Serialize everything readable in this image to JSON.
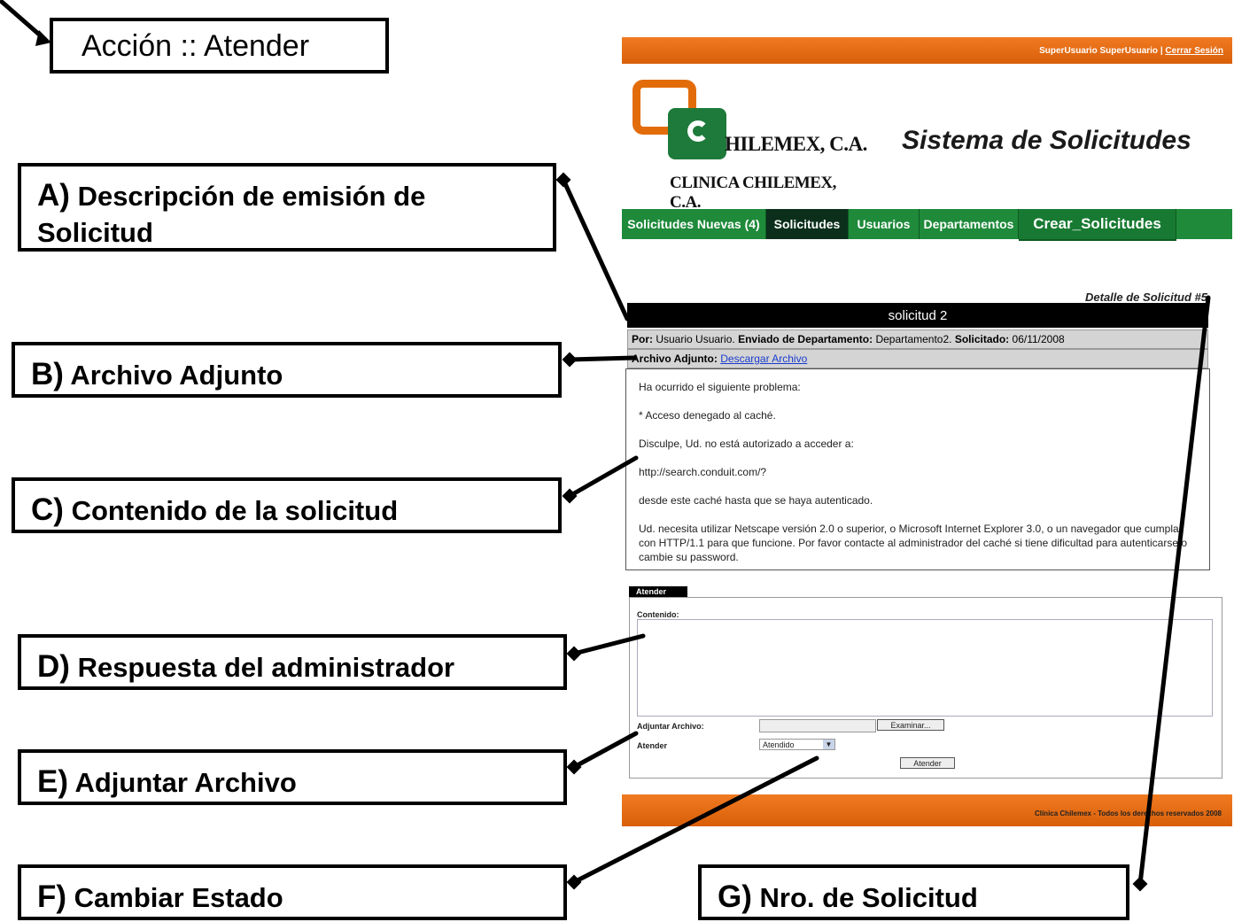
{
  "diagram_title": "Acción :: Atender",
  "callouts": {
    "a_letter": "A)",
    "a_line1": "Descripción de emisión de",
    "a_line2": "Solicitud",
    "b_letter": "B)",
    "b_text": "Archivo Adjunto",
    "c_letter": "C)",
    "c_text": "Contenido de la solicitud",
    "d_letter": "D)",
    "d_text": "Respuesta del administrador",
    "e_letter": "E)",
    "e_text": "Adjuntar Archivo",
    "f_letter": "F)",
    "f_text": "Cambiar Estado",
    "g_letter": "G)",
    "g_text": "Nro. de Solicitud"
  },
  "app": {
    "user": "SuperUsuario SuperUsuario",
    "separator": "|",
    "logout": "Cerrar Sesión",
    "logo_name": "HILEMEX, C.A.",
    "logo_sub": "CLINICA CHILEMEX, C.A.",
    "system_title": "Sistema de Solicitudes",
    "nav": [
      "Solicitudes Nuevas (4)",
      "Solicitudes",
      "Usuarios",
      "Departamentos",
      "Crear_Solicitudes"
    ],
    "detail_label": "Detalle de Solicitud #5",
    "request_title": "solicitud 2",
    "meta": {
      "by_label": "Por:",
      "by_value": "Usuario Usuario.",
      "dept_label": "Enviado de Departamento:",
      "dept_value": "Departamento2.",
      "date_label": "Solicitado:",
      "date_value": "06/11/2008"
    },
    "attachment_label": "Archivo Adjunto:",
    "attachment_link": "Descargar Archivo",
    "content": [
      "Ha ocurrido el siguiente problema:",
      "* Acceso denegado al caché.",
      "Disculpe, Ud. no está autorizado a acceder a:",
      "http://search.conduit.com/?",
      "desde este caché hasta que se haya autenticado.",
      "Ud. necesita utilizar Netscape versión 2.0 o superior, o Microsoft Internet Explorer 3.0, o un navegador que cumpla con HTTP/1.1 para que funcione. Por favor contacte al administrador del caché si tiene dificultad para autenticarse o cambie su password."
    ],
    "form": {
      "tab_label": "Atender",
      "content_label": "Contenido:",
      "attach_label": "Adjuntar Archivo:",
      "browse_button": "Examinar...",
      "status_label": "Atender",
      "status_value": "Atendido",
      "submit_button": "Atender"
    },
    "footer": "Clínica Chilemex - Todos los derechos reservados 2008",
    "colors": {
      "orange": "#e36c0a",
      "green": "#1e8a3a",
      "dark_tab": "#0b2f1b",
      "link": "#1a3ccf"
    }
  }
}
